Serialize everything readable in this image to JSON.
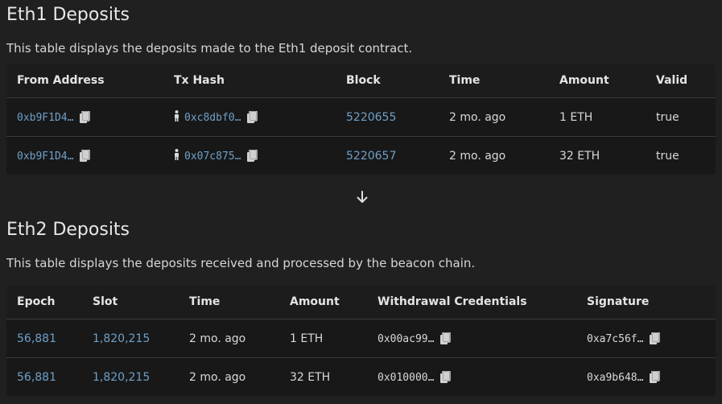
{
  "eth1": {
    "title": "Eth1 Deposits",
    "description": "This table displays the deposits made to the Eth1 deposit contract.",
    "columns": [
      "From Address",
      "Tx Hash",
      "Block",
      "Time",
      "Amount",
      "Valid"
    ],
    "rows": [
      {
        "from": "0xb9F1D4…",
        "tx": "0xc8dbf0…",
        "block": "5220655",
        "time": "2 mo. ago",
        "amount": "1 ETH",
        "valid": "true"
      },
      {
        "from": "0xb9F1D4…",
        "tx": "0x07c875…",
        "block": "5220657",
        "time": "2 mo. ago",
        "amount": "32 ETH",
        "valid": "true"
      }
    ]
  },
  "eth2": {
    "title": "Eth2 Deposits",
    "description": "This table displays the deposits received and processed by the beacon chain.",
    "columns": [
      "Epoch",
      "Slot",
      "Time",
      "Amount",
      "Withdrawal Credentials",
      "Signature"
    ],
    "rows": [
      {
        "epoch": "56,881",
        "slot": "1,820,215",
        "time": "2 mo. ago",
        "amount": "1 ETH",
        "credentials": "0x00ac99…",
        "signature": "0xa7c56f…"
      },
      {
        "epoch": "56,881",
        "slot": "1,820,215",
        "time": "2 mo. ago",
        "amount": "32 ETH",
        "credentials": "0x010000…",
        "signature": "0xa9b648…"
      }
    ]
  },
  "icons": {
    "copy": "copy-icon",
    "person": "person-icon",
    "arrow": "arrow-down-icon"
  },
  "colors": {
    "link": "#6fa0c8",
    "background": "#202020",
    "table": "#181818"
  }
}
